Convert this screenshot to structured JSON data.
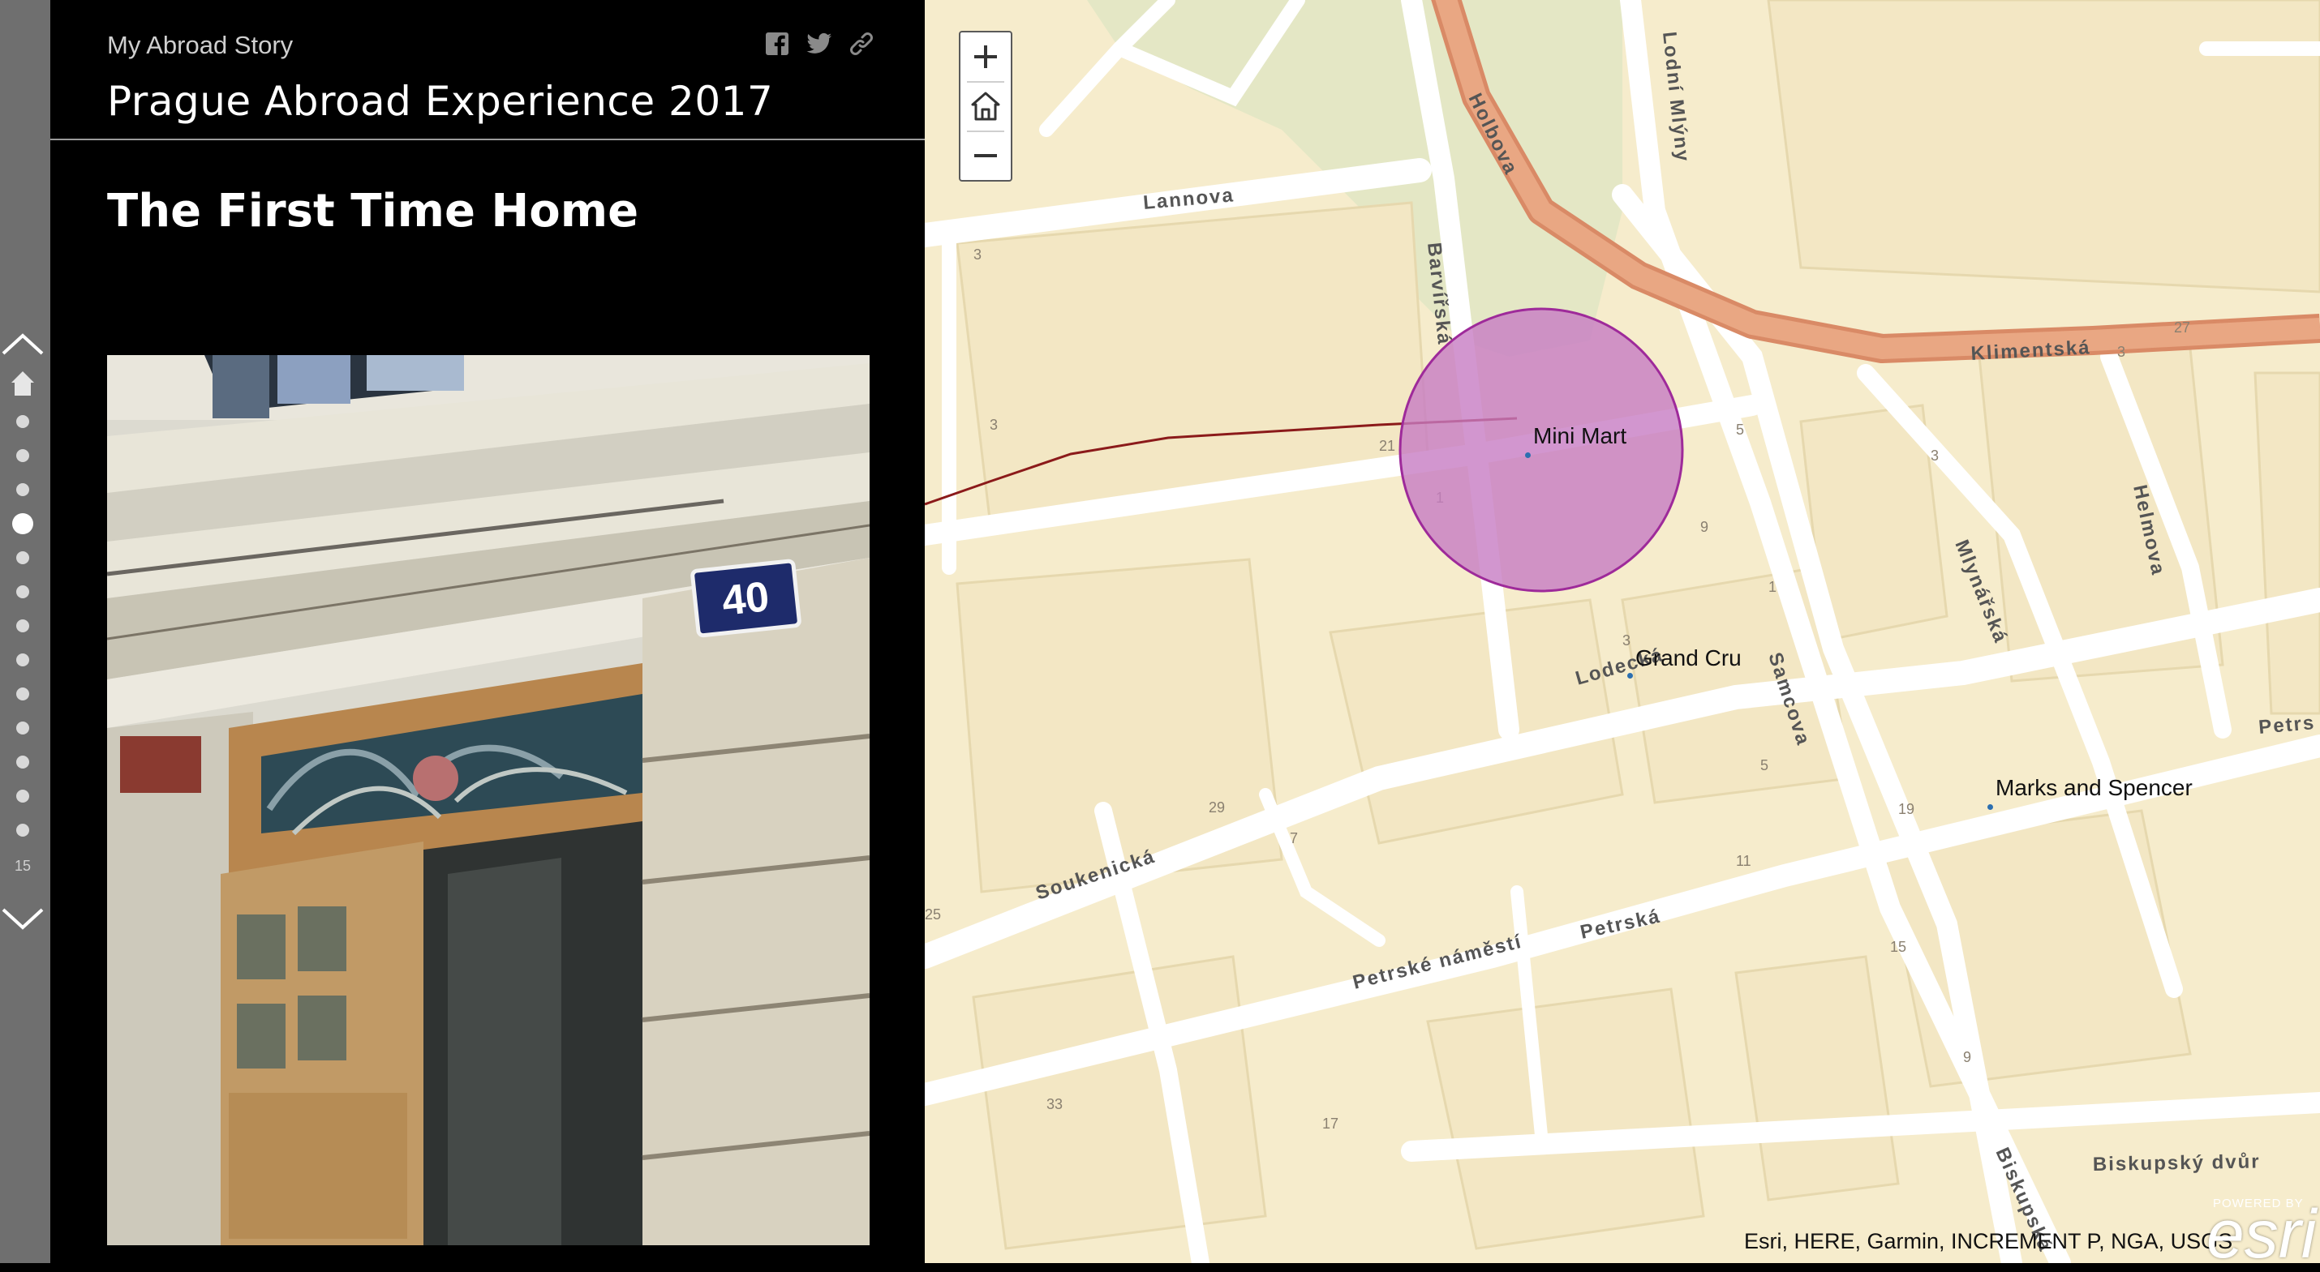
{
  "nav": {
    "active_index": 4,
    "entry_count": "15",
    "up_icon": "chevron-up-icon",
    "down_icon": "chevron-down-icon",
    "home_icon": "home-icon"
  },
  "header": {
    "story_title": "My Abroad Story",
    "main_title": "Prague Abroad Experience 2017",
    "share": [
      "facebook-icon",
      "twitter-icon",
      "link-icon"
    ]
  },
  "section": {
    "title": "The First Time Home"
  },
  "photo": {
    "house_number": "40"
  },
  "map": {
    "streets": [
      "Lannova",
      "Holbova",
      "Lodní Mlýny",
      "Barvířská",
      "Klimentská",
      "Soukenická",
      "Petrská",
      "Samcova",
      "Mlynářská",
      "Helmova",
      "Biskupský dvůr",
      "Biskupská",
      "Lodecká",
      "Petrské náměstí",
      "Petrs"
    ],
    "house_numbers": [
      "3",
      "3",
      "21",
      "1",
      "9",
      "5",
      "27",
      "3",
      "3",
      "5",
      "1",
      "3",
      "29",
      "25",
      "7",
      "11",
      "19",
      "15",
      "33",
      "17",
      "9"
    ],
    "pois": [
      "Mini Mart",
      "Grand Cru",
      "Marks and Spencer"
    ],
    "attribution": "Esri, HERE, Garmin, INCREMENT P, NGA, USGS",
    "esri_powered": "POWERED BY",
    "esri_logo": "esri",
    "colors": {
      "background": "#f6eccc",
      "road": "#ffffff",
      "park": "#e4e7c5",
      "major_road": "#e09a72",
      "buffer_fill": "#c77cc3",
      "buffer_stroke": "#9e2a9a",
      "route_line": "#8b1a1a"
    },
    "controls": {
      "zoom_in": "plus-icon",
      "home": "home-icon",
      "zoom_out": "minus-icon"
    }
  }
}
